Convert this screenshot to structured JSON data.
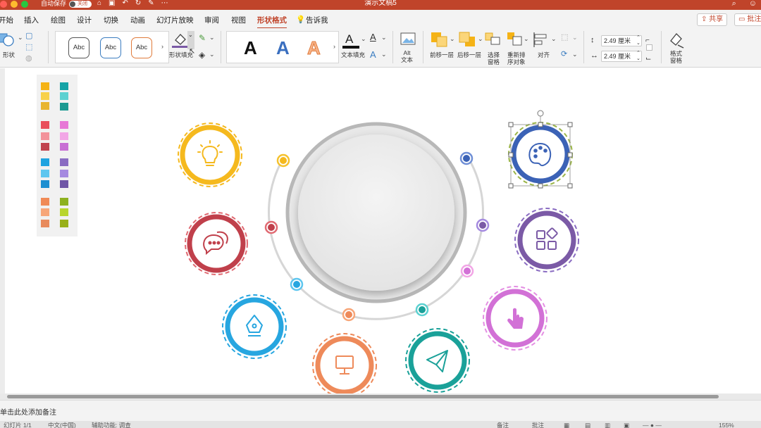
{
  "titlebar": {
    "autosave_label": "自动保存",
    "autosave_state": "关闭",
    "doc_title": "演示文稿5",
    "colors": {
      "bar": "#c0442a",
      "close": "#ff5f57",
      "min": "#febc2e",
      "max": "#28c840"
    }
  },
  "tabs": [
    {
      "label": "开始"
    },
    {
      "label": "插入"
    },
    {
      "label": "绘图"
    },
    {
      "label": "设计"
    },
    {
      "label": "切换"
    },
    {
      "label": "动画"
    },
    {
      "label": "幻灯片放映"
    },
    {
      "label": "审阅"
    },
    {
      "label": "视图"
    },
    {
      "label": "形状格式",
      "active": true
    },
    {
      "label": "告诉我"
    }
  ],
  "tabs_right": {
    "share": "共享",
    "comment": "批注"
  },
  "ribbon": {
    "shape_label": "形状",
    "style_samples": [
      "Abc",
      "Abc",
      "Abc"
    ],
    "shape_fill_label": "形状填充",
    "wordart_samples": [
      "A",
      "A",
      "A"
    ],
    "text_fill_label": "文本填充",
    "alt_text_label": "Alt\n文本",
    "bring_forward_label": "前移一层",
    "send_backward_label": "后移一层",
    "selection_pane_label": "选择\n窗格",
    "reorder_label": "重新排\n序对象",
    "align_label": "对齐",
    "height_value": "2.49 厘米",
    "width_value": "2.49 厘米",
    "format_pane_label": "格式\n窗格"
  },
  "palette": {
    "left_column": [
      "#f5b316",
      "#f8d14b",
      "#e8b52f",
      "#e94e5b",
      "#f3929a",
      "#c1444f",
      "#1fa3e0",
      "#5ec6ef",
      "#1d8fd1",
      "#f08a56",
      "#f7a679",
      "#e88a5c"
    ],
    "right_column": [
      "#16a3a6",
      "#5cd1d1",
      "#1c9a92",
      "#e778d6",
      "#f2a6e6",
      "#c86fd4",
      "#8a6cc2",
      "#a58ae0",
      "#6f56a6",
      "#8db11f",
      "#b8d52d",
      "#98b019"
    ]
  },
  "diagram": {
    "center_circle": {
      "fill": "#ececec",
      "ring": "#b8b8b8"
    },
    "nodes": [
      {
        "name": "bulb",
        "color": "#f5b91e",
        "icon": "lightbulb-icon"
      },
      {
        "name": "chat",
        "color": "#c0404b",
        "icon": "chat-bubbles-icon"
      },
      {
        "name": "pen",
        "color": "#27a6e0",
        "icon": "pen-nib-icon"
      },
      {
        "name": "monitor",
        "color": "#ee8a5a",
        "icon": "monitor-icon"
      },
      {
        "name": "send",
        "color": "#1aa199",
        "icon": "paper-plane-icon"
      },
      {
        "name": "touch",
        "color": "#d271d6",
        "icon": "tap-finger-icon"
      },
      {
        "name": "apps",
        "color": "#7b5aa6",
        "icon": "apps-grid-icon"
      },
      {
        "name": "palette",
        "color": "#3b62b6",
        "icon": "paint-palette-icon",
        "selected": true
      }
    ]
  },
  "notes": {
    "placeholder": "单击此处添加备注"
  },
  "status": {
    "slide": "幻灯片 1/1",
    "language": "中文(中国)",
    "accessibility": "辅助功能: 调查",
    "notes": "备注",
    "comments": "批注",
    "zoom": "155%"
  }
}
